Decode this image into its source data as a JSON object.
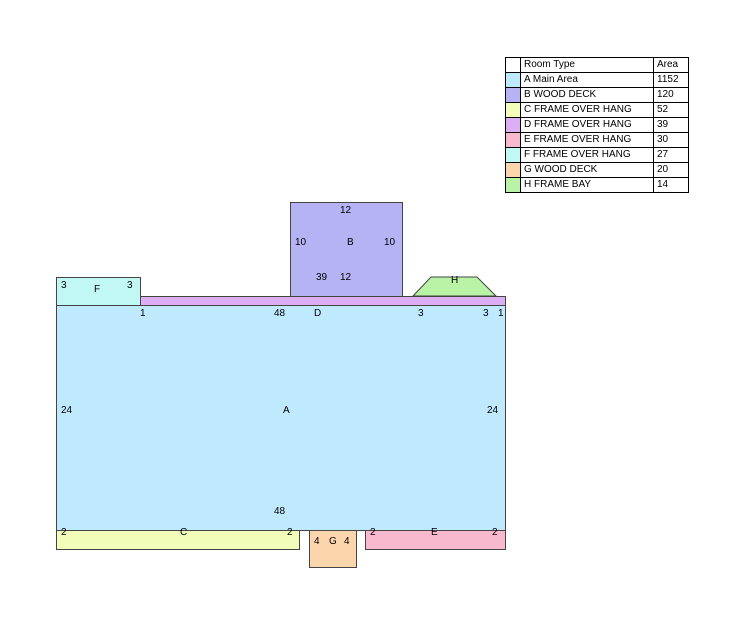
{
  "legend": {
    "header_type": "Room Type",
    "header_area": "Area",
    "rows": [
      {
        "type": "A Main Area",
        "area": "1152",
        "color": "#bfe9fd"
      },
      {
        "type": "B WOOD DECK",
        "area": "120",
        "color": "#b5b3f3"
      },
      {
        "type": "C FRAME OVER HANG",
        "area": "52",
        "color": "#f2fdb9"
      },
      {
        "type": "D FRAME OVER HANG",
        "area": "39",
        "color": "#dcaef3"
      },
      {
        "type": "E FRAME OVER HANG",
        "area": "30",
        "color": "#f8b9cf"
      },
      {
        "type": "F FRAME OVER HANG",
        "area": "27",
        "color": "#c2f8f4"
      },
      {
        "type": "G WOOD DECK",
        "area": "20",
        "color": "#fbd6ad"
      },
      {
        "type": "H FRAME BAY",
        "area": "14",
        "color": "#b9f4a6"
      }
    ]
  },
  "rooms": {
    "A": {
      "label": "A",
      "top": "48",
      "bottom": "48",
      "left": "24",
      "right": "24"
    },
    "B": {
      "label": "B",
      "top": "12",
      "bottom": "12",
      "left": "10",
      "right": "10"
    },
    "C": {
      "label": "C",
      "left": "2",
      "right": "2"
    },
    "D": {
      "label": "D",
      "left": "1",
      "length": "39",
      "right": "1",
      "mid_a": "48",
      "mid_b": "3",
      "mid_c": "3"
    },
    "E": {
      "label": "E",
      "left": "2",
      "right": "2"
    },
    "F": {
      "label": "F",
      "left": "3",
      "right": "3"
    },
    "G": {
      "label": "G",
      "left": "4",
      "right": "4"
    },
    "H": {
      "label": "H"
    }
  }
}
